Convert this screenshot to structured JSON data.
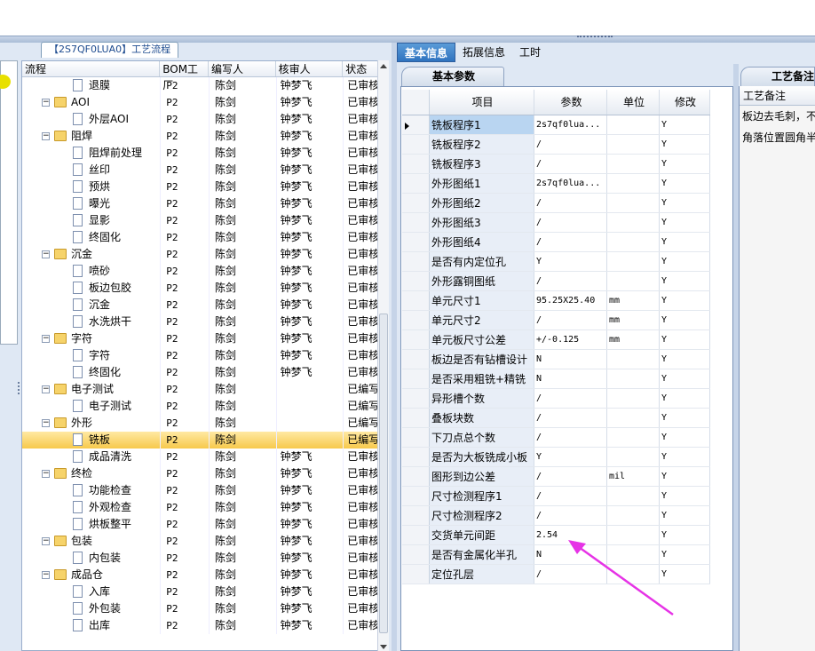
{
  "left_panel": {
    "tab_title": "【2S7QF0LUA0】工艺流程",
    "columns": [
      "流程",
      "BOM工厂",
      "编写人",
      "核审人",
      "状态"
    ],
    "rows": [
      {
        "level": 2,
        "type": "file",
        "name": "退膜",
        "bom": "P2",
        "writer": "陈剑",
        "reviewer": "钟梦飞",
        "status": "已审核"
      },
      {
        "level": 1,
        "type": "folder",
        "name": "AOI",
        "bom": "P2",
        "writer": "陈剑",
        "reviewer": "钟梦飞",
        "status": "已审核"
      },
      {
        "level": 2,
        "type": "file",
        "name": "外层AOI",
        "bom": "P2",
        "writer": "陈剑",
        "reviewer": "钟梦飞",
        "status": "已审核"
      },
      {
        "level": 1,
        "type": "folder",
        "name": "阻焊",
        "bom": "P2",
        "writer": "陈剑",
        "reviewer": "钟梦飞",
        "status": "已审核"
      },
      {
        "level": 2,
        "type": "file",
        "name": "阻焊前处理",
        "bom": "P2",
        "writer": "陈剑",
        "reviewer": "钟梦飞",
        "status": "已审核"
      },
      {
        "level": 2,
        "type": "file",
        "name": "丝印",
        "bom": "P2",
        "writer": "陈剑",
        "reviewer": "钟梦飞",
        "status": "已审核"
      },
      {
        "level": 2,
        "type": "file",
        "name": "预烘",
        "bom": "P2",
        "writer": "陈剑",
        "reviewer": "钟梦飞",
        "status": "已审核"
      },
      {
        "level": 2,
        "type": "file",
        "name": "曝光",
        "bom": "P2",
        "writer": "陈剑",
        "reviewer": "钟梦飞",
        "status": "已审核"
      },
      {
        "level": 2,
        "type": "file",
        "name": "显影",
        "bom": "P2",
        "writer": "陈剑",
        "reviewer": "钟梦飞",
        "status": "已审核"
      },
      {
        "level": 2,
        "type": "file",
        "name": "终固化",
        "bom": "P2",
        "writer": "陈剑",
        "reviewer": "钟梦飞",
        "status": "已审核"
      },
      {
        "level": 1,
        "type": "folder",
        "name": "沉金",
        "bom": "P2",
        "writer": "陈剑",
        "reviewer": "钟梦飞",
        "status": "已审核"
      },
      {
        "level": 2,
        "type": "file",
        "name": "喷砂",
        "bom": "P2",
        "writer": "陈剑",
        "reviewer": "钟梦飞",
        "status": "已审核"
      },
      {
        "level": 2,
        "type": "file",
        "name": "板边包胶",
        "bom": "P2",
        "writer": "陈剑",
        "reviewer": "钟梦飞",
        "status": "已审核"
      },
      {
        "level": 2,
        "type": "file",
        "name": "沉金",
        "bom": "P2",
        "writer": "陈剑",
        "reviewer": "钟梦飞",
        "status": "已审核"
      },
      {
        "level": 2,
        "type": "file",
        "name": "水洗烘干",
        "bom": "P2",
        "writer": "陈剑",
        "reviewer": "钟梦飞",
        "status": "已审核"
      },
      {
        "level": 1,
        "type": "folder",
        "name": "字符",
        "bom": "P2",
        "writer": "陈剑",
        "reviewer": "钟梦飞",
        "status": "已审核"
      },
      {
        "level": 2,
        "type": "file",
        "name": "字符",
        "bom": "P2",
        "writer": "陈剑",
        "reviewer": "钟梦飞",
        "status": "已审核"
      },
      {
        "level": 2,
        "type": "file",
        "name": "终固化",
        "bom": "P2",
        "writer": "陈剑",
        "reviewer": "钟梦飞",
        "status": "已审核"
      },
      {
        "level": 1,
        "type": "folder",
        "name": "电子测试",
        "bom": "P2",
        "writer": "陈剑",
        "reviewer": "",
        "status": "已编写"
      },
      {
        "level": 2,
        "type": "file",
        "name": "电子测试",
        "bom": "P2",
        "writer": "陈剑",
        "reviewer": "",
        "status": "已编写"
      },
      {
        "level": 1,
        "type": "folder",
        "name": "外形",
        "bom": "P2",
        "writer": "陈剑",
        "reviewer": "",
        "status": "已编写"
      },
      {
        "level": 2,
        "type": "file",
        "name": "铣板",
        "bom": "P2",
        "writer": "陈剑",
        "reviewer": "",
        "status": "已编写",
        "selected": true
      },
      {
        "level": 2,
        "type": "file",
        "name": "成品清洗",
        "bom": "P2",
        "writer": "陈剑",
        "reviewer": "钟梦飞",
        "status": "已审核"
      },
      {
        "level": 1,
        "type": "folder",
        "name": "终检",
        "bom": "P2",
        "writer": "陈剑",
        "reviewer": "钟梦飞",
        "status": "已审核"
      },
      {
        "level": 2,
        "type": "file",
        "name": "功能检查",
        "bom": "P2",
        "writer": "陈剑",
        "reviewer": "钟梦飞",
        "status": "已审核"
      },
      {
        "level": 2,
        "type": "file",
        "name": "外观检查",
        "bom": "P2",
        "writer": "陈剑",
        "reviewer": "钟梦飞",
        "status": "已审核"
      },
      {
        "level": 2,
        "type": "file",
        "name": "烘板整平",
        "bom": "P2",
        "writer": "陈剑",
        "reviewer": "钟梦飞",
        "status": "已审核"
      },
      {
        "level": 1,
        "type": "folder",
        "name": "包装",
        "bom": "P2",
        "writer": "陈剑",
        "reviewer": "钟梦飞",
        "status": "已审核"
      },
      {
        "level": 2,
        "type": "file",
        "name": "内包装",
        "bom": "P2",
        "writer": "陈剑",
        "reviewer": "钟梦飞",
        "status": "已审核"
      },
      {
        "level": 1,
        "type": "folder",
        "name": "成品仓",
        "bom": "P2",
        "writer": "陈剑",
        "reviewer": "钟梦飞",
        "status": "已审核"
      },
      {
        "level": 2,
        "type": "file",
        "name": "入库",
        "bom": "P2",
        "writer": "陈剑",
        "reviewer": "钟梦飞",
        "status": "已审核"
      },
      {
        "level": 2,
        "type": "file",
        "name": "外包装",
        "bom": "P2",
        "writer": "陈剑",
        "reviewer": "钟梦飞",
        "status": "已审核"
      },
      {
        "level": 2,
        "type": "file",
        "name": "出库",
        "bom": "P2",
        "writer": "陈剑",
        "reviewer": "钟梦飞",
        "status": "已审核"
      }
    ]
  },
  "right_panel": {
    "tabs": [
      "基本信息",
      "拓展信息",
      "工时"
    ],
    "active_tab": 0,
    "subtab": "基本参数",
    "grid_columns": [
      "项目",
      "参数",
      "单位",
      "修改"
    ],
    "grid_rows": [
      {
        "item": "铣板程序1",
        "param": "2s7qf0lua...",
        "unit": "",
        "mod": "Y",
        "current": true
      },
      {
        "item": "铣板程序2",
        "param": "/",
        "unit": "",
        "mod": "Y"
      },
      {
        "item": "铣板程序3",
        "param": "/",
        "unit": "",
        "mod": "Y"
      },
      {
        "item": "外形图纸1",
        "param": "2s7qf0lua...",
        "unit": "",
        "mod": "Y"
      },
      {
        "item": "外形图纸2",
        "param": "/",
        "unit": "",
        "mod": "Y"
      },
      {
        "item": "外形图纸3",
        "param": "/",
        "unit": "",
        "mod": "Y"
      },
      {
        "item": "外形图纸4",
        "param": "/",
        "unit": "",
        "mod": "Y"
      },
      {
        "item": "是否有内定位孔",
        "param": "Y",
        "unit": "",
        "mod": "Y"
      },
      {
        "item": "外形露铜图纸",
        "param": "/",
        "unit": "",
        "mod": "Y"
      },
      {
        "item": "单元尺寸1",
        "param": "95.25X25.40",
        "unit": "mm",
        "mod": "Y"
      },
      {
        "item": "单元尺寸2",
        "param": "/",
        "unit": "mm",
        "mod": "Y"
      },
      {
        "item": "单元板尺寸公差",
        "param": "+/-0.125",
        "unit": "mm",
        "mod": "Y"
      },
      {
        "item": "板边是否有钻槽设计",
        "param": "N",
        "unit": "",
        "mod": "Y"
      },
      {
        "item": "是否采用粗铣+精铣",
        "param": "N",
        "unit": "",
        "mod": "Y"
      },
      {
        "item": "异形槽个数",
        "param": "/",
        "unit": "",
        "mod": "Y"
      },
      {
        "item": "叠板块数",
        "param": "/",
        "unit": "",
        "mod": "Y"
      },
      {
        "item": "下刀点总个数",
        "param": "/",
        "unit": "",
        "mod": "Y"
      },
      {
        "item": "是否为大板铣成小板",
        "param": "Y",
        "unit": "",
        "mod": "Y"
      },
      {
        "item": "图形到边公差",
        "param": "/",
        "unit": "mil",
        "mod": "Y"
      },
      {
        "item": "尺寸检测程序1",
        "param": "/",
        "unit": "",
        "mod": "Y"
      },
      {
        "item": "尺寸检测程序2",
        "param": "/",
        "unit": "",
        "mod": "Y"
      },
      {
        "item": "交货单元间距",
        "param": "2.54",
        "unit": "",
        "mod": "Y"
      },
      {
        "item": "是否有金属化半孔",
        "param": "N",
        "unit": "",
        "mod": "Y"
      },
      {
        "item": "定位孔层",
        "param": "/",
        "unit": "",
        "mod": "Y"
      }
    ],
    "notes_tab": "工艺备注",
    "notes_header": "工艺备注",
    "notes_lines": [
      "板边去毛刺，不",
      "角落位置圆角半"
    ]
  },
  "colors": {
    "annotation_arrow": "#e633e6",
    "selected_row": "#f7c94c",
    "active_tab": "#2f73bf"
  }
}
